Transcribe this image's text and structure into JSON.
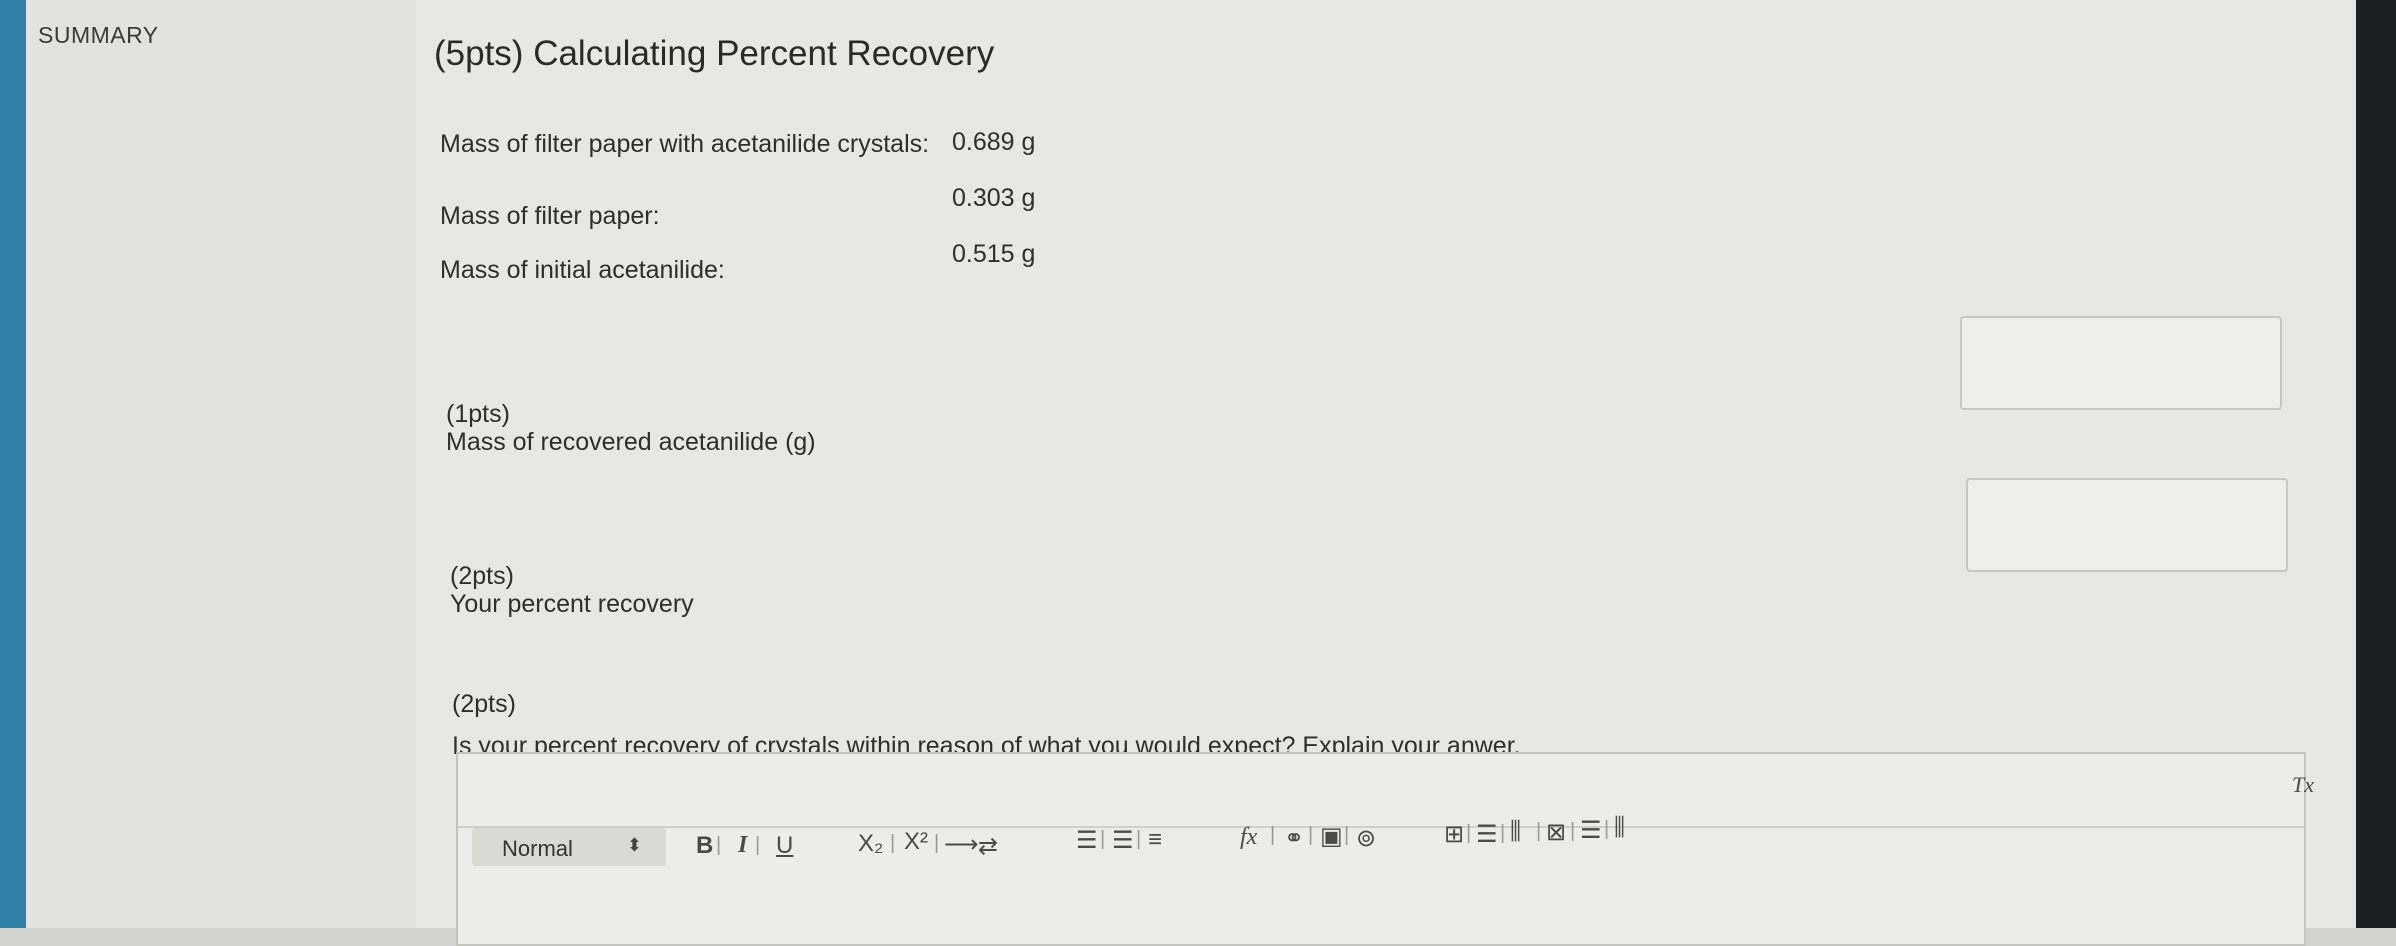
{
  "sidebar": {
    "title": "SUMMARY"
  },
  "section": {
    "title": "(5pts) Calculating Percent Recovery",
    "rows": [
      {
        "label": "Mass of filter paper with acetanilide crystals:",
        "value": "0.689 g"
      },
      {
        "label": "Mass of filter paper:",
        "value": "0.303 g"
      },
      {
        "label": "Mass of initial acetanilide:",
        "value": "0.515 g"
      }
    ]
  },
  "questions": [
    {
      "points": "(1pts)",
      "text": "Mass of recovered acetanilide (g)",
      "answer": ""
    },
    {
      "points": "(2pts)",
      "text": "Your percent recovery",
      "answer": ""
    },
    {
      "points": "(2pts)",
      "text": "Is your percent recovery of crystals within reason of what you would expect? Explain your anwer."
    }
  ],
  "editor": {
    "format_select": "Normal",
    "toolbar": {
      "bold": "B",
      "italic": "I",
      "underline": "U",
      "subscript": "X₂",
      "superscript": "X²",
      "formula": "fx",
      "clear_format": "Tx"
    },
    "icons": [
      "bold-icon",
      "italic-icon",
      "underline-icon",
      "subscript-icon",
      "superscript-icon",
      "arrow-icon",
      "equilibrium-icon",
      "ordered-list-icon",
      "bullet-list-icon",
      "align-icon",
      "formula-icon",
      "link-icon",
      "image-icon",
      "attachment-icon",
      "table-icon",
      "insert-row-icon",
      "insert-column-icon",
      "delete-table-icon",
      "delete-row-icon",
      "delete-column-icon",
      "clear-format-icon"
    ]
  }
}
